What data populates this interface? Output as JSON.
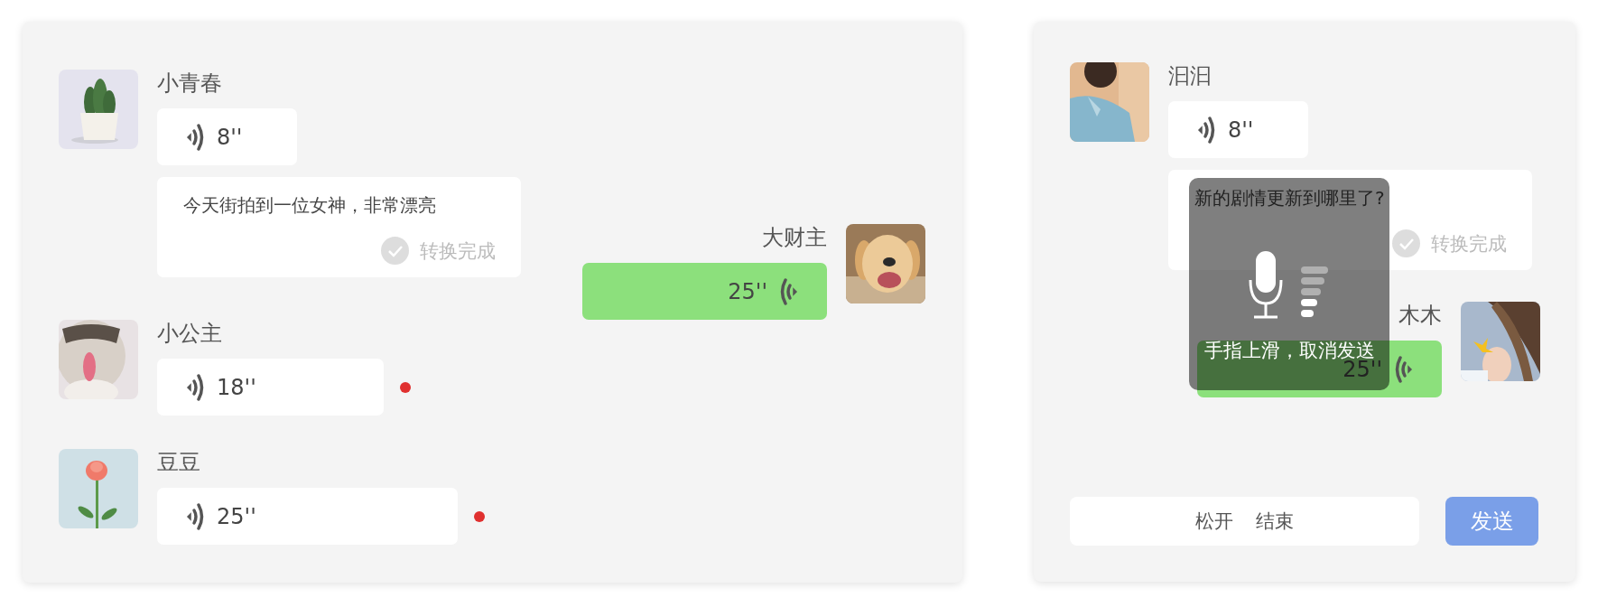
{
  "left_chat": {
    "messages": [
      {
        "kind": "incoming",
        "sender": "小青春",
        "duration": "8''",
        "unread": false,
        "transcript": {
          "text": "今天街拍到一位女神，非常漂亮",
          "status": "转换完成"
        }
      },
      {
        "kind": "outgoing",
        "sender": "大财主",
        "duration": "25''",
        "unread": false
      },
      {
        "kind": "incoming",
        "sender": "小公主",
        "duration": "18''",
        "unread": true
      },
      {
        "kind": "incoming",
        "sender": "豆豆",
        "duration": "25''",
        "unread": true
      }
    ]
  },
  "right_chat": {
    "messages": [
      {
        "kind": "incoming",
        "sender": "汩汩",
        "duration": "8''",
        "unread": false,
        "transcript": {
          "text": "新的剧情更新到哪里了?",
          "status": "转换完成"
        }
      },
      {
        "kind": "outgoing",
        "sender": "木木",
        "duration": "25''",
        "unread": false
      }
    ],
    "recording_overlay": {
      "hint": "手指上滑，取消发送",
      "level": 0.4
    },
    "hold_button": "松开  结束",
    "send_button": "发送"
  }
}
